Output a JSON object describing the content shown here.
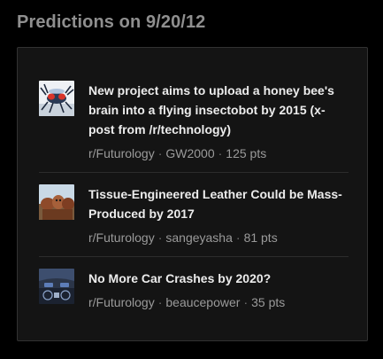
{
  "widget": {
    "title": "Predictions on 9/20/12"
  },
  "items": [
    {
      "headline": "New project aims to upload a honey bee's brain into a flying insectobot by 2015 (x-post from /r/technology)",
      "subreddit": "r/Futurology",
      "author": "GW2000",
      "points": "125 pts",
      "thumbnail_icon": "robot-bee-thumbnail"
    },
    {
      "headline": "Tissue-Engineered Leather Could be Mass-Produced by 2017",
      "subreddit": "r/Futurology",
      "author": "sangeyasha",
      "points": "81 pts",
      "thumbnail_icon": "cows-thumbnail"
    },
    {
      "headline": "No More Car Crashes by 2020?",
      "subreddit": "r/Futurology",
      "author": "beaucepower",
      "points": "35 pts",
      "thumbnail_icon": "car-dashboard-thumbnail"
    }
  ],
  "separator": "·",
  "colors": {
    "background": "#000000",
    "card": "#141414",
    "border": "#323232",
    "title": "#8f8f8f",
    "headline": "#ececec",
    "meta": "#9a9a9a"
  }
}
